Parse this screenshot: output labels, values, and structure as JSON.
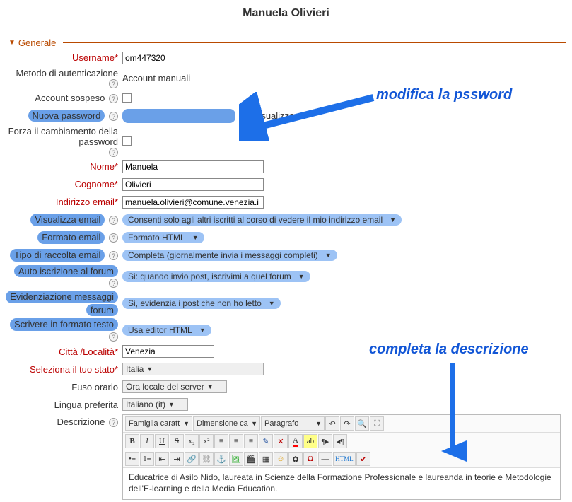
{
  "title": "Manuela Olivieri",
  "legend": "Generale",
  "annotations": {
    "password": "modifica la pssword",
    "description": "completa la descrizione"
  },
  "labels": {
    "username": "Username",
    "auth_method": "Metodo di autenticazione",
    "suspended": "Account sospeso",
    "new_password": "Nuova password",
    "show_pw": "Visualizza",
    "force_pw": "Forza il cambiamento della password",
    "first_name": "Nome",
    "last_name": "Cognome",
    "email": "Indirizzo email",
    "email_display": "Visualizza email",
    "email_format": "Formato email",
    "digest_type": "Tipo di raccolta email",
    "auto_subscribe": "Auto iscrizione al forum",
    "highlight": "Evidenziazione messaggi forum",
    "text_format": "Scrivere in formato testo",
    "city": "Città /Località",
    "country": "Seleziona il tuo stato",
    "timezone": "Fuso orario",
    "language": "Lingua preferita",
    "description": "Descrizione"
  },
  "values": {
    "username": "om447320",
    "auth_method": "Account manuali",
    "first_name": "Manuela",
    "last_name": "Olivieri",
    "email": "manuela.olivieri@comune.venezia.i",
    "email_display": "Consenti solo agli altri iscritti al corso di vedere il mio indirizzo email",
    "email_format": "Formato HTML",
    "digest_type": "Completa (giornalmente invia i messaggi completi)",
    "auto_subscribe": "Si: quando invio post, iscrivimi a quel forum",
    "highlight": "Si, evidenzia i post che non ho letto",
    "text_format": "Usa editor HTML",
    "city": "Venezia",
    "country": "Italia",
    "timezone": "Ora locale del server",
    "language": "Italiano (it)",
    "description_body": "Educatrice di Asilo Nido, laureata in Scienze della Formazione Professionale e laureanda in teorie e Metodologie dell'E-learning e della Media Education."
  },
  "editor": {
    "font_family": "Famiglia caratt",
    "font_size": "Dimensione ca",
    "block": "Paragrafo",
    "html_btn": "HTML"
  }
}
